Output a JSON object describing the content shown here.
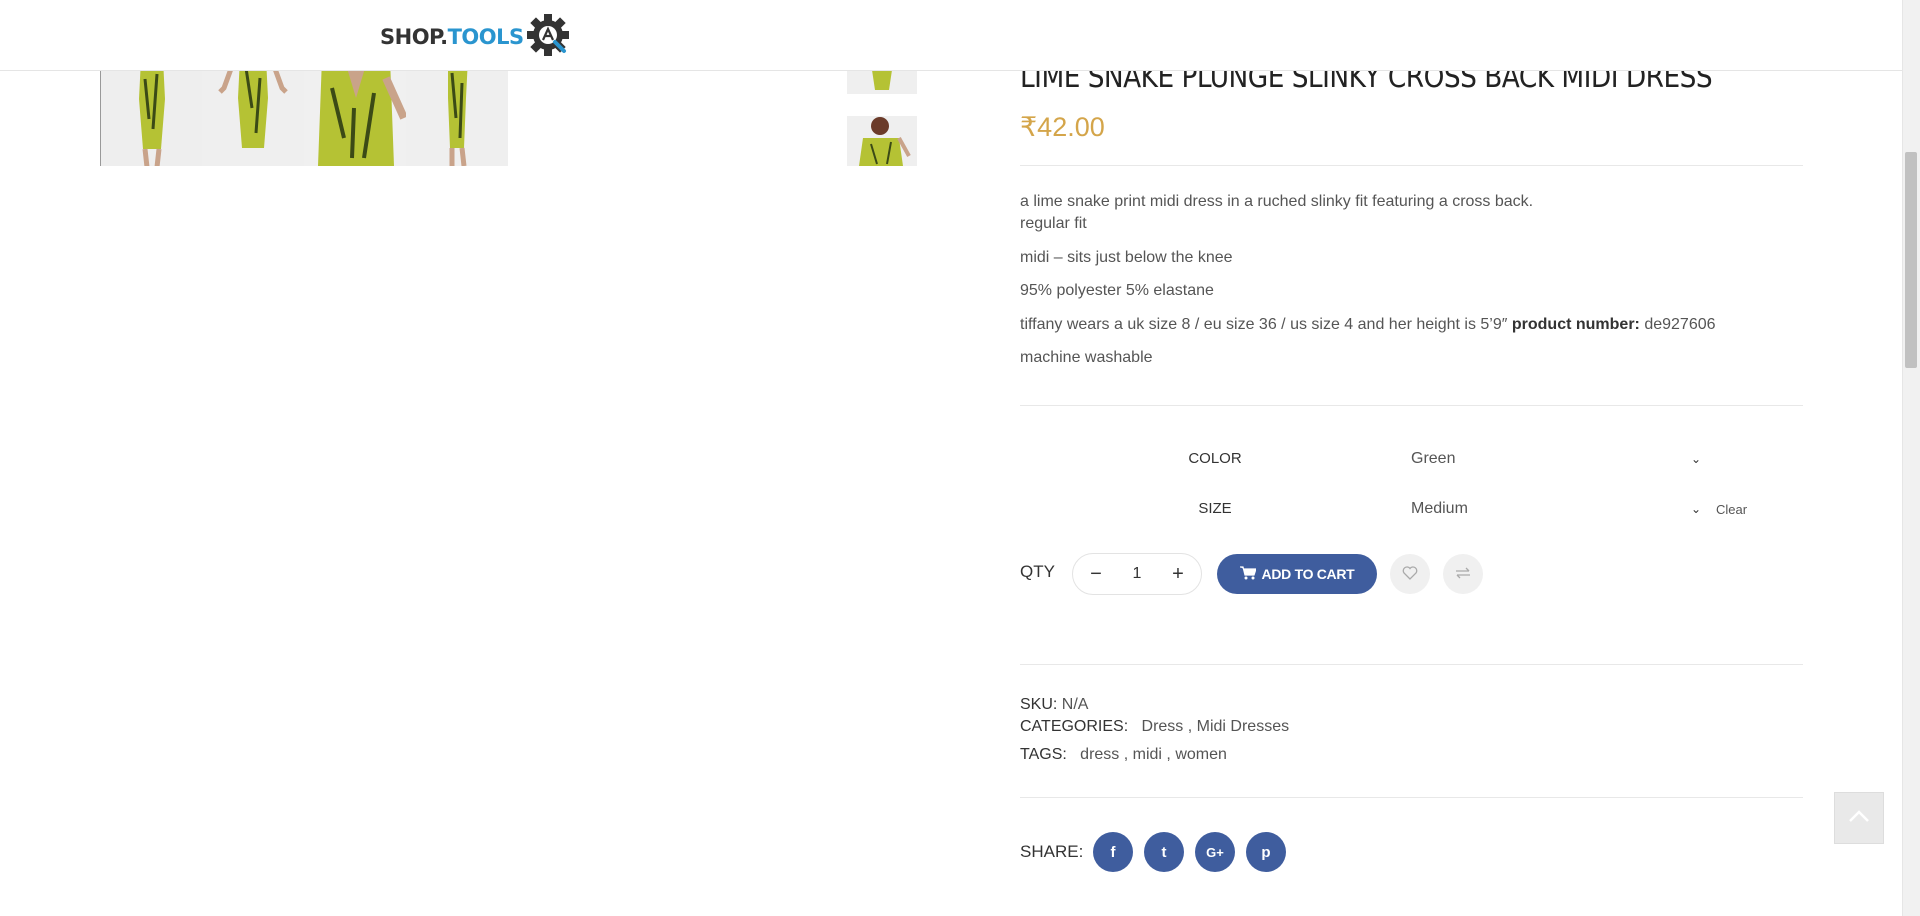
{
  "header": {
    "logo_shop": "SHOP.",
    "logo_tools": "TOOLS"
  },
  "product": {
    "title": "LIME SNAKE PLUNGE SLINKY CROSS BACK MIDI DRESS",
    "price": "₹42.00",
    "description": [
      "a lime snake print midi dress in a ruched slinky fit featuring a cross back.",
      "regular fit",
      "midi – sits just below the knee",
      "95% polyester 5% elastane",
      "tiffany wears a uk size 8 / eu size 36 / us size 4 and her height is 5’9″",
      "machine washable"
    ],
    "product_number_label": "product number:",
    "product_number": "de927606"
  },
  "variations": {
    "color_label": "COLOR",
    "color_value": "Green",
    "size_label": "SIZE",
    "size_value": "Medium",
    "clear_label": "Clear"
  },
  "cart": {
    "qty_label": "QTY",
    "qty_minus": "−",
    "qty_value": "1",
    "qty_plus": "+",
    "add_to_cart_label": "ADD TO CART"
  },
  "meta": {
    "sku_label": "SKU:",
    "sku_value": "N/A",
    "categories_label": "CATEGORIES:",
    "categories": [
      "Dress",
      "Midi Dresses"
    ],
    "tags_label": "TAGS:",
    "tags": [
      "dress",
      "midi",
      "women"
    ]
  },
  "share": {
    "label": "SHARE:",
    "networks": [
      {
        "icon": "facebook-icon",
        "glyph": "f"
      },
      {
        "icon": "twitter-icon",
        "glyph": "t"
      },
      {
        "icon": "google-plus-icon",
        "glyph": "G+"
      },
      {
        "icon": "pinterest-icon",
        "glyph": "p"
      }
    ]
  },
  "colors": {
    "accent_blue": "#3f5d9e",
    "price_gold": "#d4a54a",
    "logo_blue": "#2a95cf",
    "dress_lime": "#b5c234"
  }
}
